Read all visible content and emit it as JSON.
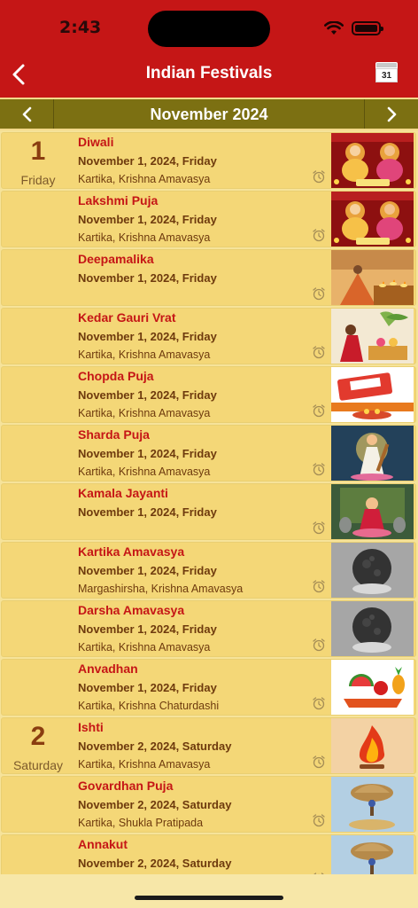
{
  "status": {
    "time": "2:43"
  },
  "header": {
    "title": "Indian Festivals",
    "calendar_day": "31"
  },
  "month_nav": {
    "label": "November 2024"
  },
  "festivals": [
    {
      "day_num": "1",
      "day_name": "Friday",
      "name": "Diwali",
      "date": "November 1, 2024, Friday",
      "month": "Kartika, Krishna Amavasya",
      "thumb": "lakshmi-ganesha"
    },
    {
      "day_num": "",
      "day_name": "",
      "name": "Lakshmi Puja",
      "date": "November 1, 2024, Friday",
      "month": "Kartika, Krishna Amavasya",
      "thumb": "lakshmi-ganesha"
    },
    {
      "day_num": "",
      "day_name": "",
      "name": "Deepamalika",
      "date": "November 1, 2024, Friday",
      "month": "",
      "thumb": "lamps"
    },
    {
      "day_num": "",
      "day_name": "",
      "name": "Kedar Gauri Vrat",
      "date": "November 1, 2024, Friday",
      "month": "Kartika, Krishna Amavasya",
      "thumb": "puja-woman"
    },
    {
      "day_num": "",
      "day_name": "",
      "name": "Chopda Puja",
      "date": "November 1, 2024, Friday",
      "month": "Kartika, Krishna Amavasya",
      "thumb": "ledger"
    },
    {
      "day_num": "",
      "day_name": "",
      "name": "Sharda Puja",
      "date": "November 1, 2024, Friday",
      "month": "Kartika, Krishna Amavasya",
      "thumb": "saraswati"
    },
    {
      "day_num": "",
      "day_name": "",
      "name": "Kamala Jayanti",
      "date": "November 1, 2024, Friday",
      "month": "",
      "thumb": "kamala"
    },
    {
      "day_num": "",
      "day_name": "",
      "name": "Kartika Amavasya",
      "date": "November 1, 2024, Friday",
      "month": "Margashirsha, Krishna Amavasya",
      "thumb": "new-moon"
    },
    {
      "day_num": "",
      "day_name": "",
      "name": "Darsha Amavasya",
      "date": "November 1, 2024, Friday",
      "month": "Kartika, Krishna Amavasya",
      "thumb": "new-moon"
    },
    {
      "day_num": "",
      "day_name": "",
      "name": "Anvadhan",
      "date": "November 1, 2024, Friday",
      "month": "Kartika, Krishna Chaturdashi",
      "thumb": "fruits"
    },
    {
      "day_num": "2",
      "day_name": "Saturday",
      "name": "Ishti",
      "date": "November 2, 2024, Saturday",
      "month": "Kartika, Krishna Amavasya",
      "thumb": "fire"
    },
    {
      "day_num": "",
      "day_name": "",
      "name": "Govardhan Puja",
      "date": "November 2, 2024, Saturday",
      "month": "Kartika, Shukla Pratipada",
      "thumb": "govardhan"
    },
    {
      "day_num": "",
      "day_name": "",
      "name": "Annakut",
      "date": "November 2, 2024, Saturday",
      "month": "",
      "thumb": "govardhan"
    }
  ],
  "colors": {
    "header_bg": "#c51616",
    "month_bar_bg": "#7c7012",
    "row_bg": "#f4d777",
    "festival_name": "#c51616",
    "text_brown": "#6e3a0d"
  }
}
